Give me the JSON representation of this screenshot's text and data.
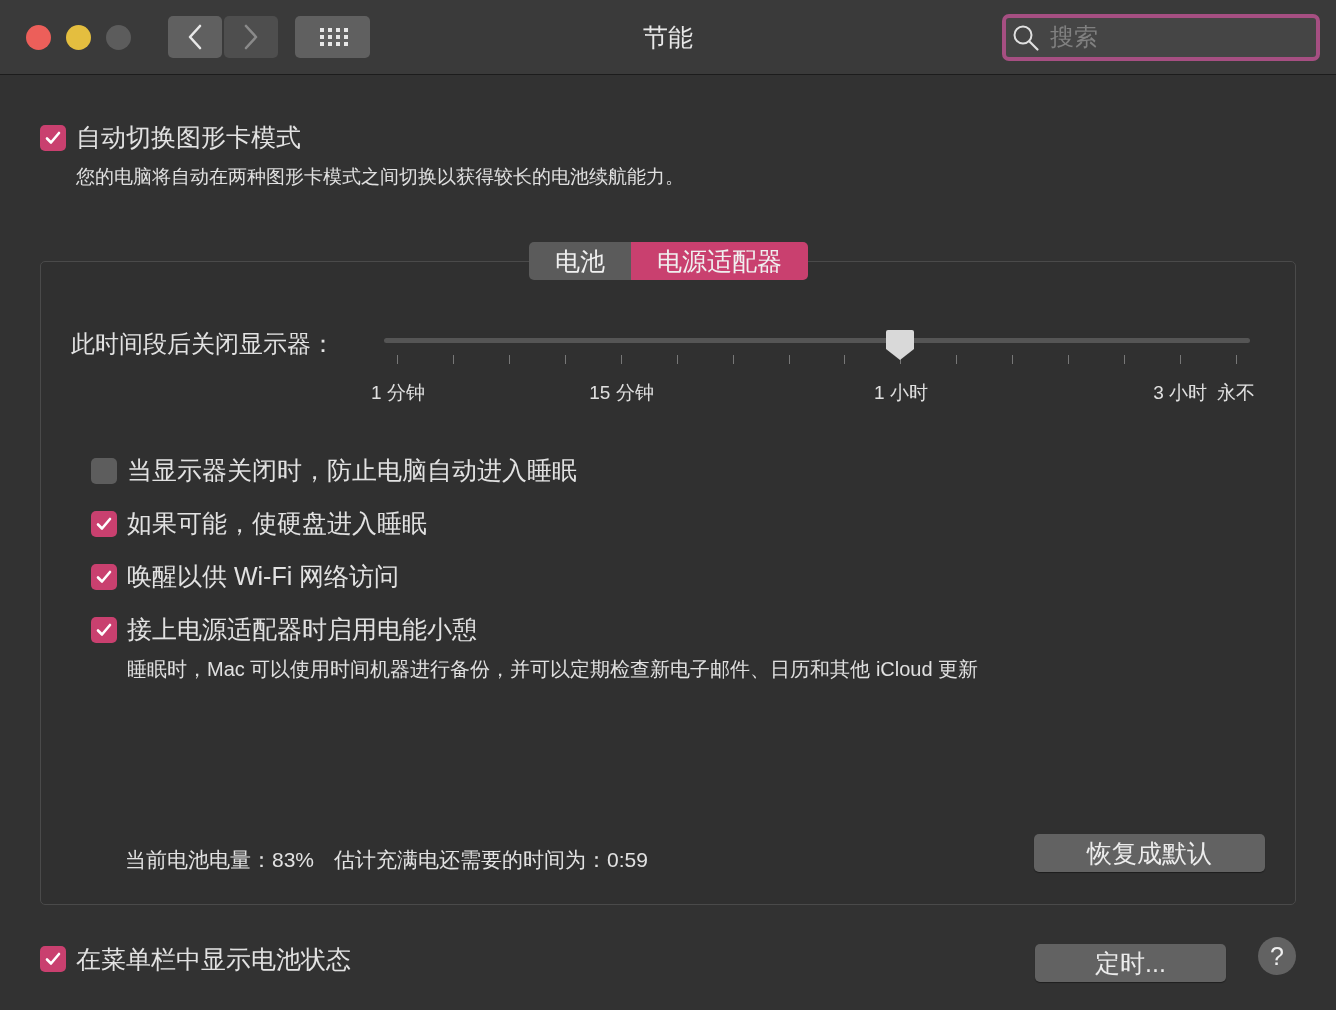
{
  "window": {
    "title": "节能"
  },
  "nav_buttons": [
    {
      "kind": "back",
      "disabled": false
    },
    {
      "kind": "forward",
      "disabled": true
    }
  ],
  "search": {
    "placeholder": "搜索",
    "focused": true
  },
  "graphics_switching": {
    "label": "自动切换图形卡模式",
    "description": "您的电脑将自动在两种图形卡模式之间切换以获得较长的电池续航能力。",
    "checked": true
  },
  "tabs": [
    {
      "label": "电池",
      "selected": false
    },
    {
      "label": "电源适配器",
      "selected": true
    }
  ],
  "display_sleep": {
    "label": "此时间段后关闭显示器：",
    "level": 0.596,
    "tick_labels": [
      "1 分钟",
      "15 分钟",
      "1 小时",
      "3 小时",
      "永不"
    ]
  },
  "options": [
    {
      "label": "当显示器关闭时，防止电脑自动进入睡眠",
      "checked": false
    },
    {
      "label": "如果可能，使硬盘进入睡眠",
      "checked": true
    },
    {
      "label": "唤醒以供 Wi-Fi 网络访问",
      "checked": true
    },
    {
      "label": "接上电源适配器时启用电能小憩",
      "checked": true,
      "note": "睡眠时，Mac 可以使用时间机器进行备份，并可以定期检查新电子邮件、日历和其他 iCloud 更新"
    }
  ],
  "battery_status": [
    "当前电池电量：83%",
    "估计充满电还需要的时间为：0:59"
  ],
  "restore_button": "恢复成默认",
  "menu_bar_option": {
    "label": "在菜单栏中显示电池状态",
    "checked": true
  },
  "schedule_button": "定时...",
  "help_button": "?"
}
